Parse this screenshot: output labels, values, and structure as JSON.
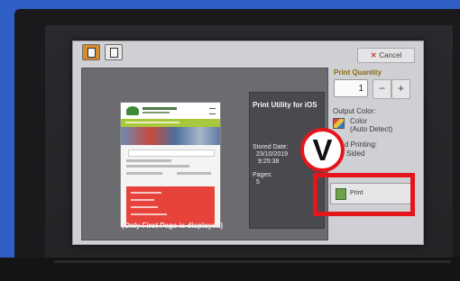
{
  "toolbar": {
    "cancel_label": "Cancel"
  },
  "preview": {
    "caption": "(Only First Page is displayed)"
  },
  "info": {
    "title": "Print Utility for iOS",
    "stored_date_label": "Stored Date:",
    "stored_date": "23/10/2019",
    "stored_time": "9:25:38",
    "pages_label": "Pages:",
    "pages": "5"
  },
  "options": {
    "quantity_label": "Print Quantity",
    "quantity_value": "1",
    "minus": "−",
    "plus": "+",
    "output_color_label": "Output Color:",
    "output_color_value": "Color",
    "output_color_detail": "(Auto Detect)",
    "sided_printing_label": "d Printing:",
    "sided_printing_value": "Sided"
  },
  "actions": {
    "print_label": "Print"
  },
  "annotation": {
    "badge": "V",
    "accent": "#e4161b"
  },
  "icons": [
    "document-icon",
    "layout-icon",
    "close-icon",
    "color-output-icon",
    "printer-icon"
  ]
}
